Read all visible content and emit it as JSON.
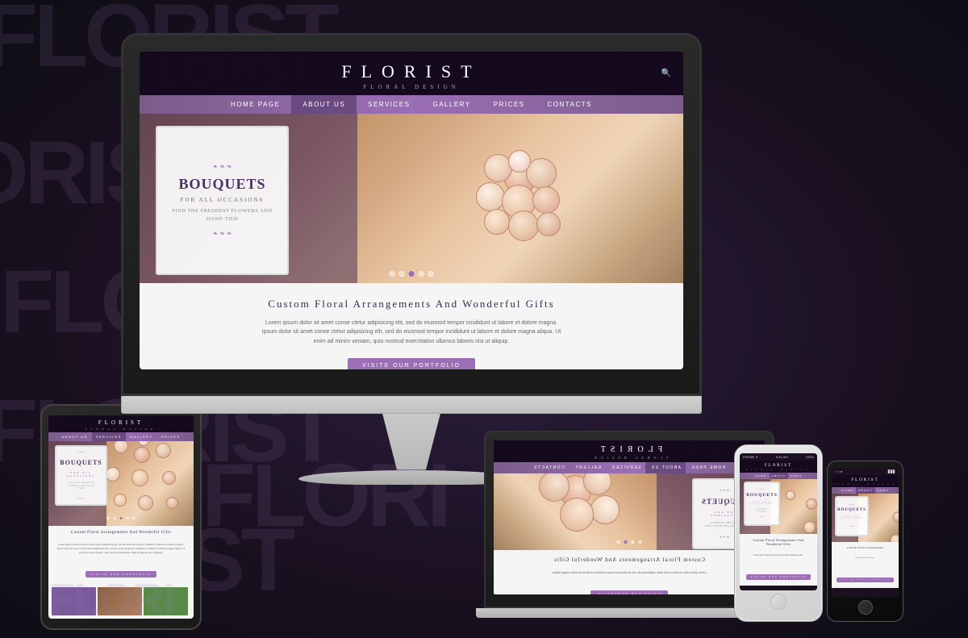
{
  "scene": {
    "background_color": "#1a1020"
  },
  "website": {
    "logo": "FLORIST",
    "tagline": "FLORAL DESIGN",
    "nav": {
      "items": [
        {
          "label": "HOME PAGE",
          "active": false
        },
        {
          "label": "ABOUT US",
          "active": true
        },
        {
          "label": "SERVICES",
          "active": false
        },
        {
          "label": "GALLERY",
          "active": false
        },
        {
          "label": "PRICES",
          "active": false
        },
        {
          "label": "CONTACTS",
          "active": false
        }
      ]
    },
    "hero": {
      "title": "BOUQUETS",
      "subtitle": "FOR ALL OCCASIONS",
      "description": "FIND THE FRESHEST FLOWERS AND HAND TIED",
      "dots": [
        false,
        false,
        true,
        false,
        false
      ]
    },
    "content": {
      "heading": "Custom Floral Arrangements and wonderful gifts",
      "body": "Lorem ipsum dolor sit amet conse ctetur adipisicing elit, sed do eiusmod tempor incididunt ut labore et dolore magna. Ipsum dolor sit amet conse ctetur adipisicing elit, sed do eiusmod tempor incididunt ut labore et dolore magna aliqua. Ut enim ad minim veniam, quis nostrud exercitation ullamco laboris nisi ut aliquip.",
      "button_label": "VISITE OUR PORTFOLIO"
    }
  },
  "watermarks": [
    "FLORIST",
    "FLORI",
    "ORIST",
    "FLORIST",
    "FLORI",
    "ORIST",
    "FLORIST",
    "FLORI",
    "ORIST"
  ],
  "devices": {
    "imac": {
      "label": "iMac display"
    },
    "macbook": {
      "label": "MacBook"
    },
    "tablet": {
      "label": "iPad"
    },
    "iphone1": {
      "label": "iPhone white",
      "status_time": "9:41 AM",
      "status_carrier": "PHONE ✦",
      "battery": "100%"
    },
    "iphone2": {
      "label": "iPhone black"
    }
  }
}
